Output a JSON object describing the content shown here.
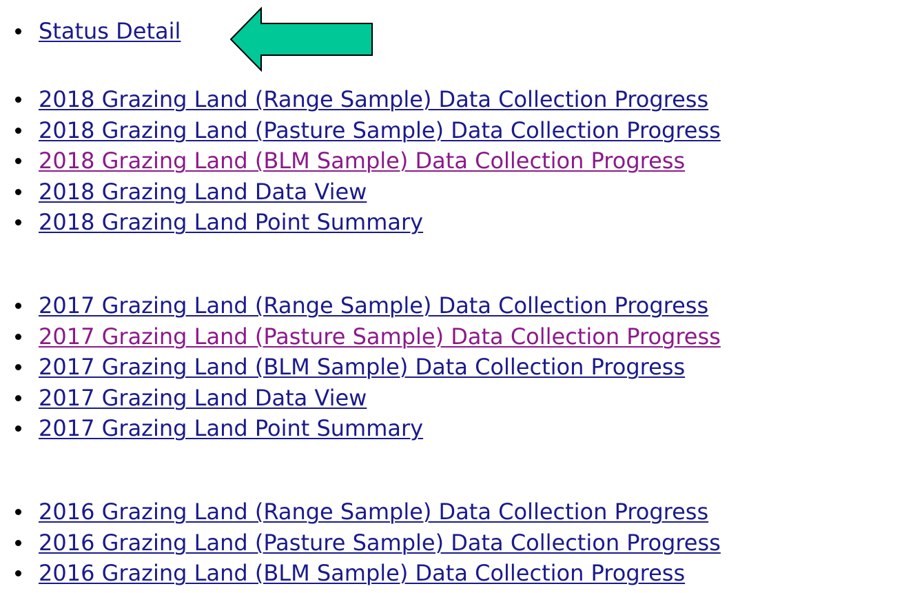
{
  "status": {
    "label": "Status Detail",
    "visited": false
  },
  "groups": [
    {
      "year": "2018",
      "links": [
        {
          "label": "2018 Grazing Land (Range Sample) Data Collection Progress",
          "visited": false
        },
        {
          "label": "2018 Grazing Land (Pasture Sample) Data Collection Progress",
          "visited": false
        },
        {
          "label": "2018 Grazing Land (BLM Sample) Data Collection Progress",
          "visited": true
        },
        {
          "label": "2018 Grazing Land Data View",
          "visited": false
        },
        {
          "label": "2018 Grazing Land Point Summary",
          "visited": false
        }
      ]
    },
    {
      "year": "2017",
      "links": [
        {
          "label": "2017 Grazing Land (Range Sample) Data Collection Progress",
          "visited": false
        },
        {
          "label": "2017 Grazing Land (Pasture Sample) Data Collection Progress",
          "visited": true
        },
        {
          "label": "2017 Grazing Land (BLM Sample) Data Collection Progress",
          "visited": false
        },
        {
          "label": "2017 Grazing Land Data View",
          "visited": false
        },
        {
          "label": "2017 Grazing Land Point Summary",
          "visited": false
        }
      ]
    },
    {
      "year": "2016",
      "links": [
        {
          "label": "2016 Grazing Land (Range Sample) Data Collection Progress",
          "visited": false
        },
        {
          "label": "2016 Grazing Land (Pasture Sample) Data Collection Progress",
          "visited": false
        },
        {
          "label": "2016 Grazing Land (BLM Sample) Data Collection Progress",
          "visited": false
        }
      ]
    }
  ],
  "callout": {
    "icon": "left-arrow-icon",
    "fill": "#00c896",
    "stroke": "#000000"
  },
  "colors": {
    "link": "#1a1a8c",
    "visited_link": "#8b1a8b"
  }
}
